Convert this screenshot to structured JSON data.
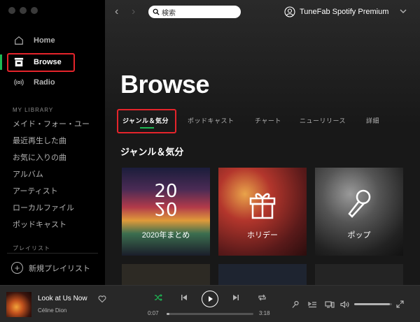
{
  "sidebar": {
    "nav": [
      {
        "label": "Home",
        "icon": "home-icon"
      },
      {
        "label": "Browse",
        "icon": "browse-icon"
      },
      {
        "label": "Radio",
        "icon": "radio-icon"
      }
    ],
    "library_heading": "MY LIBRARY",
    "library_items": [
      "メイド・フォー・ユー",
      "最近再生した曲",
      "お気に入りの曲",
      "アルバム",
      "アーティスト",
      "ローカルファイル",
      "ポッドキャスト"
    ],
    "playlists_heading": "プレイリスト",
    "new_playlist_label": "新規プレイリスト"
  },
  "topbar": {
    "search_value": "検索",
    "user_name": "TuneFab Spotify Premium"
  },
  "main": {
    "title": "Browse",
    "tabs": [
      "ジャンル＆気分",
      "ポッドキャスト",
      "チャート",
      "ニューリリース",
      "詳細"
    ],
    "section_heading": "ジャンル＆気分",
    "cards": [
      {
        "label": "2020年まとめ",
        "art_top": "20",
        "art_bottom": "20"
      },
      {
        "label": "ホリデー",
        "icon": "gift-icon"
      },
      {
        "label": "ポップ",
        "icon": "microphone-icon"
      }
    ]
  },
  "player": {
    "title": "Look at Us Now",
    "artist": "Céline Dion",
    "elapsed": "0:07",
    "duration": "3:18",
    "progress": 0.035,
    "volume": 0.95
  },
  "colors": {
    "accent": "#1db954",
    "highlight": "#e5242b",
    "sidebar_bg": "#000000",
    "main_bg": "#181818",
    "player_bg": "#282828"
  }
}
